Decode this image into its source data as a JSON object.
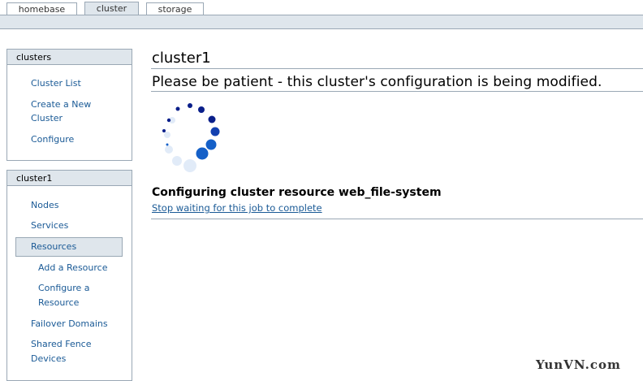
{
  "tabs": [
    {
      "label": "homebase",
      "active": false
    },
    {
      "label": "cluster",
      "active": true
    },
    {
      "label": "storage",
      "active": false
    }
  ],
  "sidebar": {
    "clusters_panel": {
      "title": "clusters",
      "items": [
        "Cluster List",
        "Create a New",
        "Cluster",
        "Configure"
      ]
    },
    "cluster1_panel": {
      "title": "cluster1",
      "items": [
        "Nodes",
        "Services",
        "Resources",
        "Add a Resource",
        "Configure a",
        "Resource",
        "Failover Domains",
        "Shared Fence",
        "Devices"
      ],
      "selected": "Resources"
    }
  },
  "main": {
    "title": "cluster1",
    "message": "Please be patient - this cluster's configuration is being modified.",
    "job_text": "Configuring cluster resource web_file-system",
    "stop_link": "Stop waiting for this job to complete"
  },
  "watermark": "YunVN.com",
  "colors": {
    "band": "#dfe6ec",
    "border": "#9aa8b5",
    "link": "#1a5a96",
    "spinner_dark": "#0a1f8a",
    "spinner_light": "#1560c8"
  },
  "icons": {
    "spinner": "loading-spinner-icon"
  }
}
